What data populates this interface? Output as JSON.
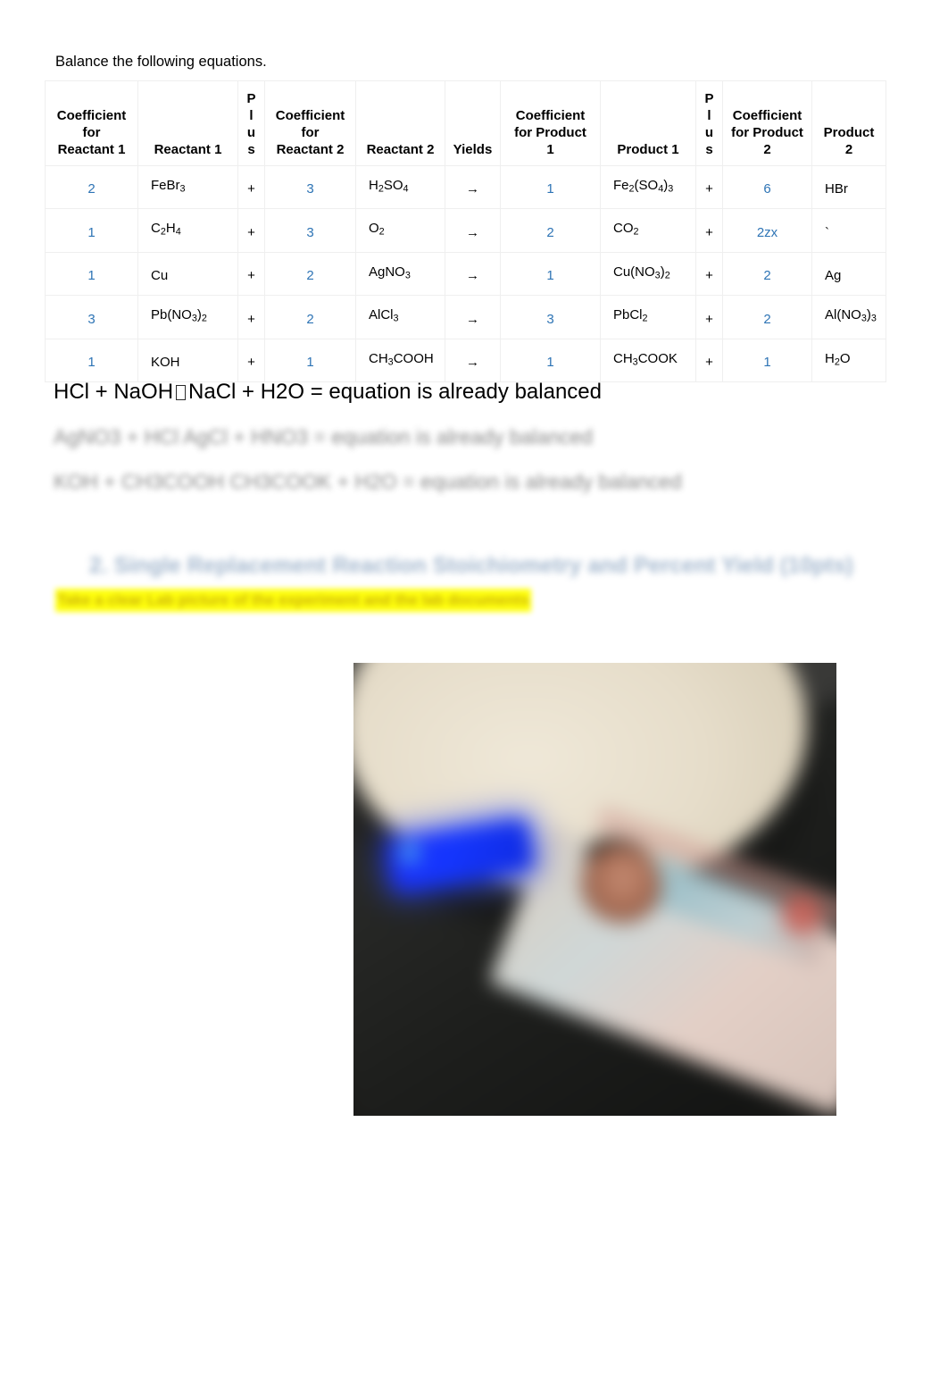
{
  "document": {
    "intro_text": "Balance the following equations.",
    "table": {
      "headers": {
        "coefficient_for_reactant_1": [
          "Coefficient",
          "for",
          "Reactant 1"
        ],
        "reactant_1": "Reactant 1",
        "plus_1": [
          "P",
          "l",
          "u",
          "s"
        ],
        "coefficient_for_reactant_2": [
          "Coefficient",
          "for",
          "Reactant 2"
        ],
        "reactant_2": "Reactant 2",
        "yields": "Yields",
        "coefficient_for_product_1": [
          "Coefficient",
          "for Product",
          "1"
        ],
        "product_1": "Product 1",
        "plus_2": [
          "P",
          "l",
          "u",
          "s"
        ],
        "coefficient_for_product_2": [
          "Coefficient",
          "for Product",
          "2"
        ],
        "product_2": [
          "Product",
          "2"
        ]
      },
      "rows": [
        {
          "coef_r1": "2",
          "reactant_1": "FeBr<sub>3</sub>",
          "plus_1": "+",
          "coef_r2": "3",
          "reactant_2": "H<sub>2</sub>SO<sub>4</sub>",
          "yields": "→",
          "coef_p1": "1",
          "product_1": "Fe<sub>2</sub>(SO<sub>4</sub>)<sub>3</sub>",
          "plus_2": "+",
          "coef_p2": "6",
          "product_2": "HBr"
        },
        {
          "coef_r1": "1",
          "reactant_1": "C<sub>2</sub>H<sub>4</sub>",
          "plus_1": "+",
          "coef_r2": "3",
          "reactant_2": "O<sub>2</sub>",
          "yields": "→",
          "coef_p1": "2",
          "product_1": "CO<sub>2</sub>",
          "plus_2": "+",
          "coef_p2": "2zx",
          "product_2": "`"
        },
        {
          "coef_r1": "1",
          "reactant_1": "Cu",
          "plus_1": "+",
          "coef_r2": "2",
          "reactant_2": "AgNO<sub>3</sub>",
          "yields": "→",
          "coef_p1": "1",
          "product_1": "Cu(NO<sub>3</sub>)<sub>2</sub>",
          "plus_2": "+",
          "coef_p2": "2",
          "product_2": "Ag"
        },
        {
          "coef_r1": "3",
          "reactant_1": "Pb(NO<sub>3</sub>)<sub>2</sub>",
          "plus_1": "+",
          "coef_r2": "2",
          "reactant_2": "AlCl<sub>3</sub>",
          "yields": "→",
          "coef_p1": "3",
          "product_1": "PbCl<sub>2</sub>",
          "plus_2": "+",
          "coef_p2": "2",
          "product_2": "Al(NO<sub>3</sub>)<sub>3</sub>"
        },
        {
          "coef_r1": "1",
          "reactant_1": "KOH",
          "plus_1": "+",
          "coef_r2": "1",
          "reactant_2": "CH<sub>3</sub>COOH",
          "yields": "→",
          "coef_p1": "1",
          "product_1": "CH<sub>3</sub>COOK",
          "plus_2": "+",
          "coef_p2": "1",
          "product_2": "H<sub>2</sub>O"
        }
      ]
    },
    "answer_lines": [
      {
        "id": "line-hcl-naoh",
        "before_glyph": "HCl + NaOH",
        "missing_glyph": "□",
        "after_glyph": "NaCl + H2O = equation is already balanced",
        "blurred": false
      },
      {
        "id": "line-blurred-1",
        "text": "AgNO3 + HCl AgCl + HNO3 = equation is already balanced",
        "blurred": true
      },
      {
        "id": "line-blurred-2",
        "text": "KOH + CH3COOH CH3COOK + H2O = equation is already balanced",
        "blurred": true
      }
    ],
    "section_heading": {
      "number": "2.",
      "text": "Single Replacement Reaction Stoichiometry and Percent Yield (10pts)",
      "blurred": true
    },
    "highlighted_note": {
      "text": "Take a clear Lab picture of the experiment and the lab documents",
      "highlight_color": "#FFFF00",
      "blurred": true
    },
    "photo": {
      "caption": "blurred photograph of a digital kitchen scale with a blue backlit display next to a laminated card on a dark table",
      "alt_name": "lab-photo"
    },
    "colors": {
      "coefficient_blue": "#2E74B5",
      "heading_blue": "#9AB0C9",
      "highlight_yellow": "#FFFF00",
      "table_border": "#EFEFEF",
      "text_black": "#000000"
    }
  }
}
